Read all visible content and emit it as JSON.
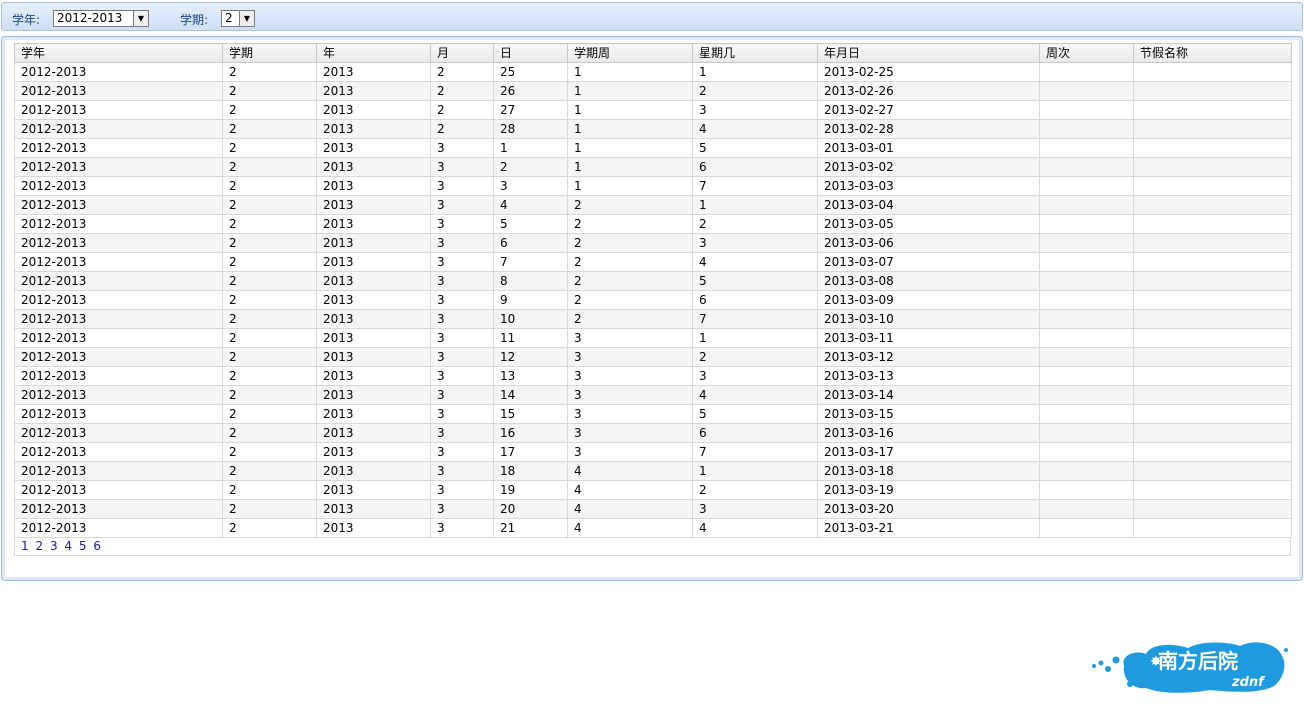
{
  "filters": {
    "year_label": "学年:",
    "year_value": "2012-2013",
    "term_label": "学期:",
    "term_value": "2"
  },
  "table": {
    "columns": [
      "学年",
      "学期",
      "年",
      "月",
      "日",
      "学期周",
      "星期几",
      "年月日",
      "周次",
      "节假名称"
    ],
    "rows": [
      [
        "2012-2013",
        "2",
        "2013",
        "2",
        "25",
        "1",
        "1",
        "2013-02-25",
        "",
        ""
      ],
      [
        "2012-2013",
        "2",
        "2013",
        "2",
        "26",
        "1",
        "2",
        "2013-02-26",
        "",
        ""
      ],
      [
        "2012-2013",
        "2",
        "2013",
        "2",
        "27",
        "1",
        "3",
        "2013-02-27",
        "",
        ""
      ],
      [
        "2012-2013",
        "2",
        "2013",
        "2",
        "28",
        "1",
        "4",
        "2013-02-28",
        "",
        ""
      ],
      [
        "2012-2013",
        "2",
        "2013",
        "3",
        "1",
        "1",
        "5",
        "2013-03-01",
        "",
        ""
      ],
      [
        "2012-2013",
        "2",
        "2013",
        "3",
        "2",
        "1",
        "6",
        "2013-03-02",
        "",
        ""
      ],
      [
        "2012-2013",
        "2",
        "2013",
        "3",
        "3",
        "1",
        "7",
        "2013-03-03",
        "",
        ""
      ],
      [
        "2012-2013",
        "2",
        "2013",
        "3",
        "4",
        "2",
        "1",
        "2013-03-04",
        "",
        ""
      ],
      [
        "2012-2013",
        "2",
        "2013",
        "3",
        "5",
        "2",
        "2",
        "2013-03-05",
        "",
        ""
      ],
      [
        "2012-2013",
        "2",
        "2013",
        "3",
        "6",
        "2",
        "3",
        "2013-03-06",
        "",
        ""
      ],
      [
        "2012-2013",
        "2",
        "2013",
        "3",
        "7",
        "2",
        "4",
        "2013-03-07",
        "",
        ""
      ],
      [
        "2012-2013",
        "2",
        "2013",
        "3",
        "8",
        "2",
        "5",
        "2013-03-08",
        "",
        ""
      ],
      [
        "2012-2013",
        "2",
        "2013",
        "3",
        "9",
        "2",
        "6",
        "2013-03-09",
        "",
        ""
      ],
      [
        "2012-2013",
        "2",
        "2013",
        "3",
        "10",
        "2",
        "7",
        "2013-03-10",
        "",
        ""
      ],
      [
        "2012-2013",
        "2",
        "2013",
        "3",
        "11",
        "3",
        "1",
        "2013-03-11",
        "",
        ""
      ],
      [
        "2012-2013",
        "2",
        "2013",
        "3",
        "12",
        "3",
        "2",
        "2013-03-12",
        "",
        ""
      ],
      [
        "2012-2013",
        "2",
        "2013",
        "3",
        "13",
        "3",
        "3",
        "2013-03-13",
        "",
        ""
      ],
      [
        "2012-2013",
        "2",
        "2013",
        "3",
        "14",
        "3",
        "4",
        "2013-03-14",
        "",
        ""
      ],
      [
        "2012-2013",
        "2",
        "2013",
        "3",
        "15",
        "3",
        "5",
        "2013-03-15",
        "",
        ""
      ],
      [
        "2012-2013",
        "2",
        "2013",
        "3",
        "16",
        "3",
        "6",
        "2013-03-16",
        "",
        ""
      ],
      [
        "2012-2013",
        "2",
        "2013",
        "3",
        "17",
        "3",
        "7",
        "2013-03-17",
        "",
        ""
      ],
      [
        "2012-2013",
        "2",
        "2013",
        "3",
        "18",
        "4",
        "1",
        "2013-03-18",
        "",
        ""
      ],
      [
        "2012-2013",
        "2",
        "2013",
        "3",
        "19",
        "4",
        "2",
        "2013-03-19",
        "",
        ""
      ],
      [
        "2012-2013",
        "2",
        "2013",
        "3",
        "20",
        "4",
        "3",
        "2013-03-20",
        "",
        ""
      ],
      [
        "2012-2013",
        "2",
        "2013",
        "3",
        "21",
        "4",
        "4",
        "2013-03-21",
        "",
        ""
      ]
    ]
  },
  "pager": {
    "pages": [
      "1",
      "2",
      "3",
      "4",
      "5",
      "6"
    ]
  },
  "logo": {
    "title": "南方后院",
    "subtitle": "zdnf",
    "color": "#1e9be0"
  }
}
